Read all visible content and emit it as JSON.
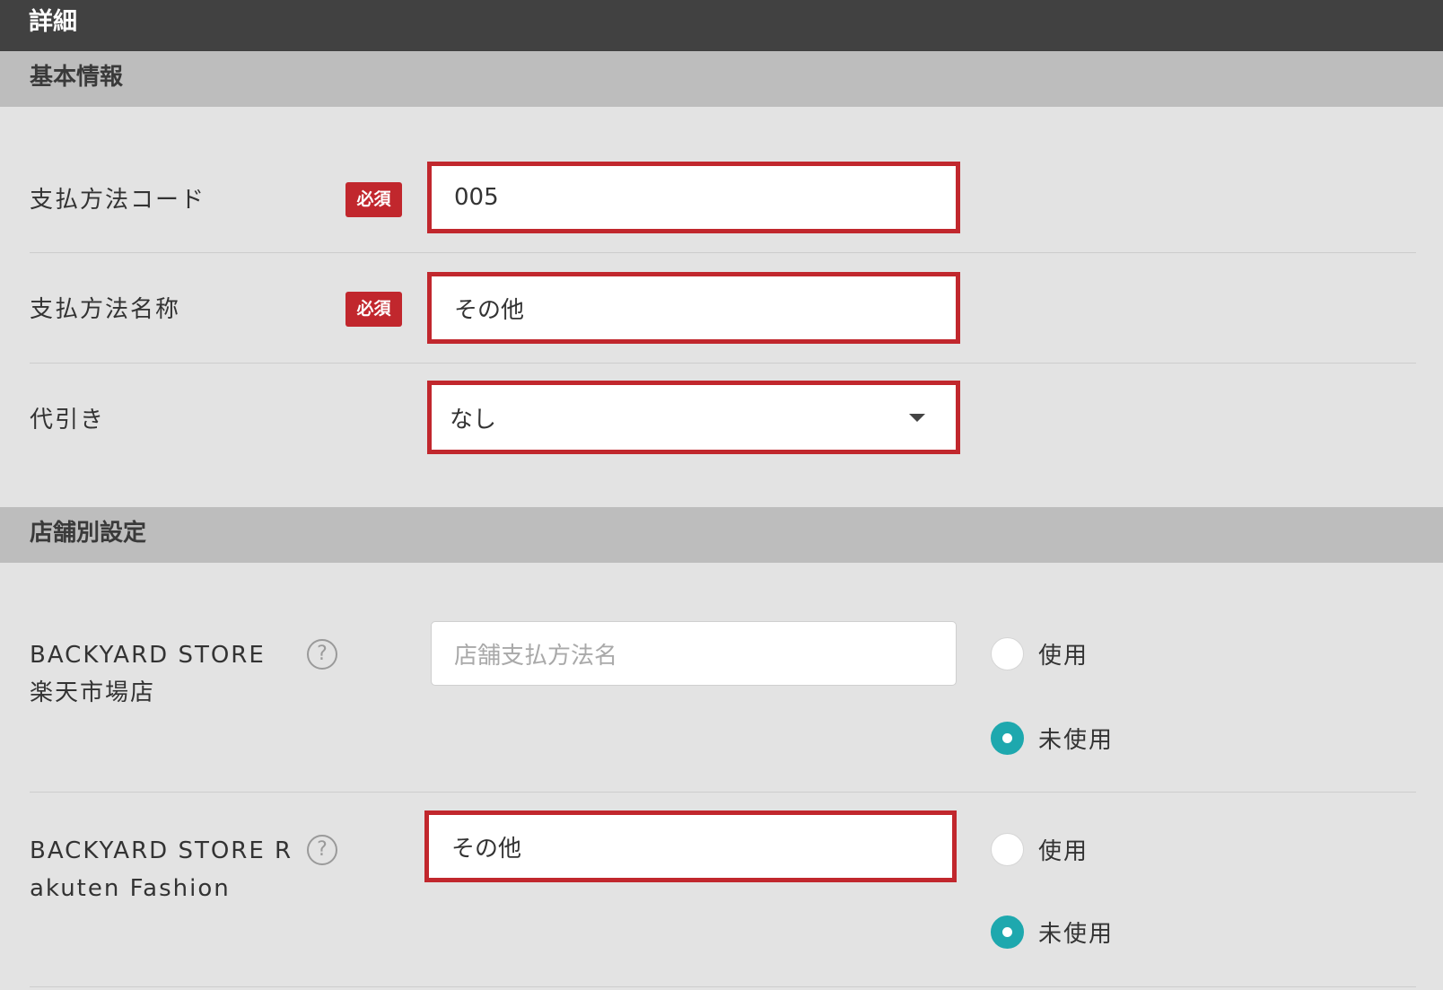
{
  "header": {
    "title": "詳細"
  },
  "basic_section": {
    "title": "基本情報",
    "payment_code": {
      "label": "支払方法コード",
      "required_badge": "必須",
      "value": "005"
    },
    "payment_name": {
      "label": "支払方法名称",
      "required_badge": "必須",
      "value": "その他"
    },
    "cod": {
      "label": "代引き",
      "selected": "なし"
    }
  },
  "store_section": {
    "title": "店舗別設定",
    "stores": [
      {
        "name_line1": "BACKYARD STORE",
        "name_line2": "楽天市場店",
        "help_icon": "question-circle-icon",
        "input_value": "",
        "input_placeholder": "店舗支払方法名",
        "option_use": "使用",
        "option_unused": "未使用",
        "selected": "未使用"
      },
      {
        "name_line1": "BACKYARD STORE R",
        "name_line2": "akuten Fashion",
        "help_icon": "question-circle-icon",
        "input_value": "その他",
        "input_placeholder": "",
        "option_use": "使用",
        "option_unused": "未使用",
        "selected": "未使用"
      }
    ]
  },
  "colors": {
    "header_bg": "#414141",
    "section_bg": "#bdbdbd",
    "page_bg": "#e3e3e3",
    "highlight_border": "#c1272d",
    "required_badge": "#c1272d",
    "radio_selected": "#1ea8ae"
  }
}
